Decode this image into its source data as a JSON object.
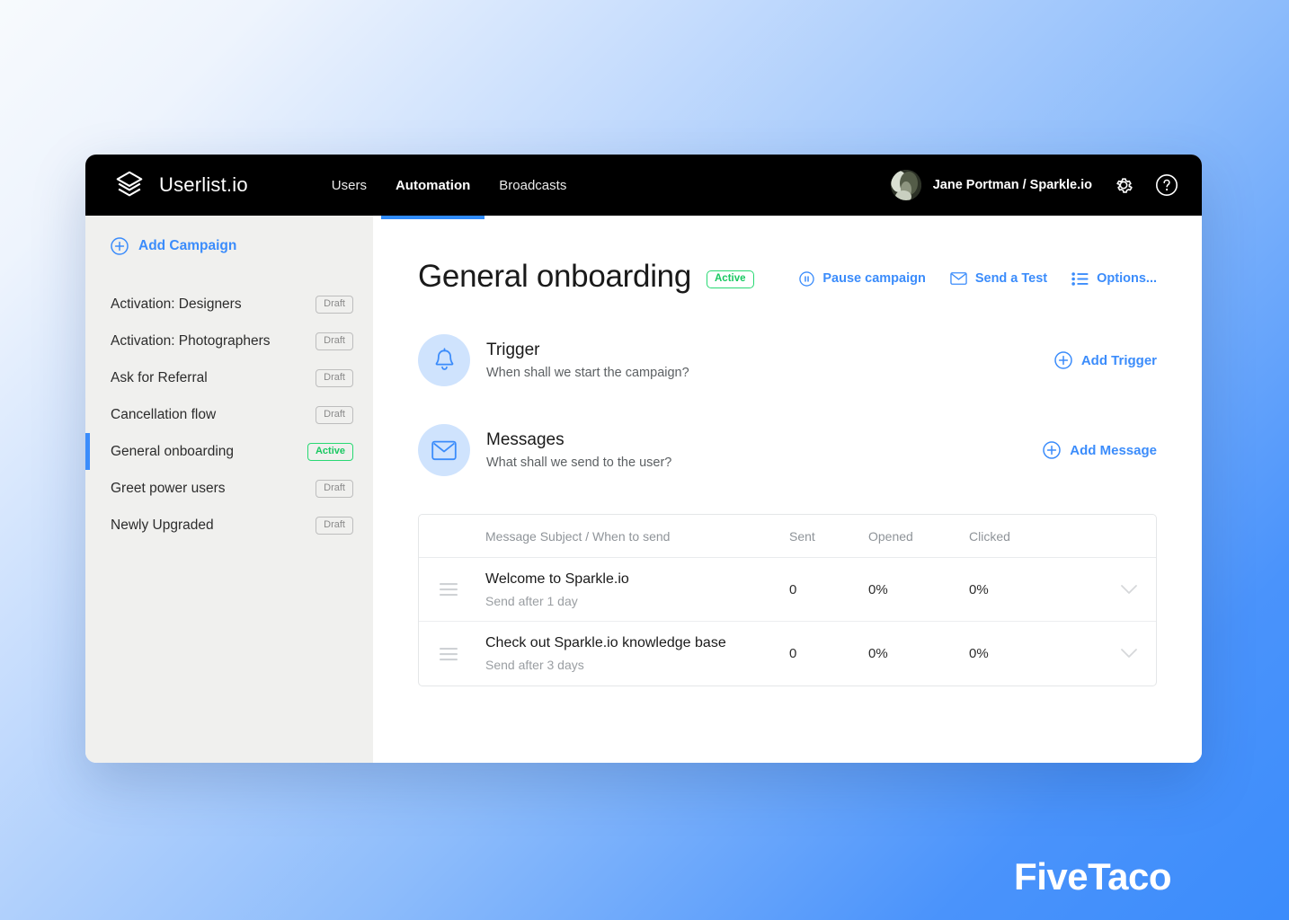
{
  "brand": {
    "name": "Userlist.io",
    "logo_icon": "stacked-layers-icon"
  },
  "nav": {
    "links": [
      {
        "label": "Users",
        "active": false
      },
      {
        "label": "Automation",
        "active": true
      },
      {
        "label": "Broadcasts",
        "active": false
      }
    ],
    "user": {
      "name": "Jane Portman / Sparkle.io",
      "avatar_icon": "user-avatar"
    },
    "settings_icon": "gear-icon",
    "help_icon": "question-circle-icon"
  },
  "sidebar": {
    "add_campaign": {
      "label": "Add Campaign",
      "icon": "plus-circle-icon"
    },
    "campaigns": [
      {
        "label": "Activation: Designers",
        "status": "Draft",
        "selected": false
      },
      {
        "label": "Activation: Photographers",
        "status": "Draft",
        "selected": false
      },
      {
        "label": "Ask for Referral",
        "status": "Draft",
        "selected": false
      },
      {
        "label": "Cancellation flow",
        "status": "Draft",
        "selected": false
      },
      {
        "label": "General onboarding",
        "status": "Active",
        "selected": true
      },
      {
        "label": "Greet power users",
        "status": "Draft",
        "selected": false
      },
      {
        "label": "Newly Upgraded",
        "status": "Draft",
        "selected": false
      }
    ]
  },
  "main": {
    "title": "General onboarding",
    "title_status": "Active",
    "actions": [
      {
        "label": "Pause campaign",
        "icon": "pause-circle-icon"
      },
      {
        "label": "Send a Test",
        "icon": "envelope-icon"
      },
      {
        "label": "Options...",
        "icon": "list-bullets-icon"
      }
    ],
    "sections": [
      {
        "title": "Trigger",
        "subtitle": "When shall we start the campaign?",
        "icon": "bell-icon",
        "action": {
          "label": "Add Trigger",
          "icon": "plus-circle-icon"
        }
      },
      {
        "title": "Messages",
        "subtitle": "What shall we send to the user?",
        "icon": "envelope-icon",
        "action": {
          "label": "Add Message",
          "icon": "plus-circle-icon"
        }
      }
    ],
    "table": {
      "columns": [
        "Message Subject / When to send",
        "Sent",
        "Opened",
        "Clicked"
      ],
      "rows": [
        {
          "subject": "Welcome to Sparkle.io",
          "when": "Send after 1 day",
          "sent": "0",
          "opened": "0%",
          "clicked": "0%",
          "handle_icon": "drag-handle-icon",
          "expand_icon": "chevron-down-icon"
        },
        {
          "subject": "Check out Sparkle.io knowledge base",
          "when": "Send after 3 days",
          "sent": "0",
          "opened": "0%",
          "clicked": "0%",
          "handle_icon": "drag-handle-icon",
          "expand_icon": "chevron-down-icon"
        }
      ]
    }
  },
  "watermark": {
    "label": "FiveTaco"
  },
  "colors": {
    "accent_blue": "#3b8cfb",
    "active_green": "#19c861",
    "topbar_black": "#000000",
    "sidebar_gray": "#f0f0ee"
  }
}
